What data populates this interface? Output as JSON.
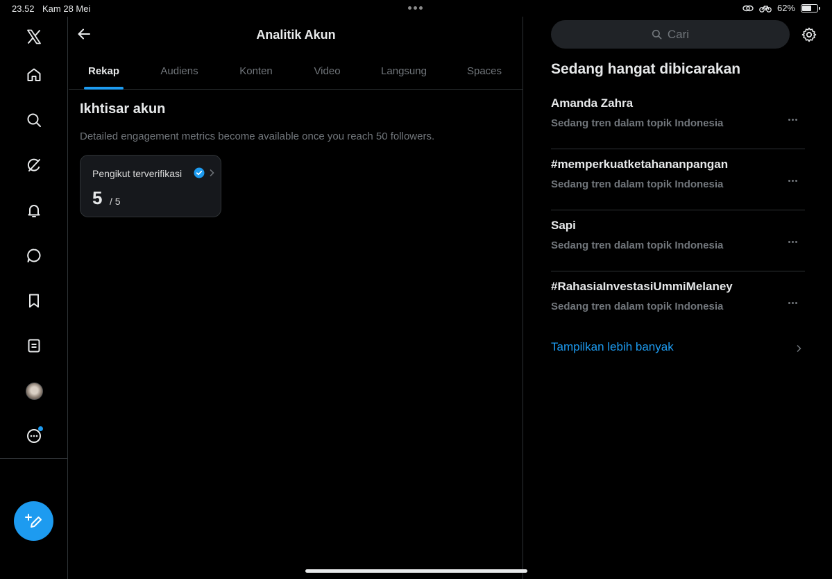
{
  "status_bar": {
    "time": "23.52",
    "date": "Kam 28 Mei",
    "battery_text": "62%",
    "battery_level": 0.62
  },
  "nav": {
    "icons": [
      "x-logo-icon",
      "home-icon",
      "search-icon",
      "grok-icon",
      "notifications-bell-icon",
      "messages-icon",
      "bookmark-icon",
      "lists-icon",
      "avatar",
      "more-icon",
      "compose-icon"
    ]
  },
  "header": {
    "title": "Analitik Akun"
  },
  "tabs": [
    {
      "label": "Rekap",
      "active": true
    },
    {
      "label": "Audiens",
      "active": false
    },
    {
      "label": "Konten",
      "active": false
    },
    {
      "label": "Video",
      "active": false
    },
    {
      "label": "Langsung",
      "active": false
    },
    {
      "label": "Spaces",
      "active": false
    }
  ],
  "overview": {
    "title": "Ikhtisar akun",
    "description": "Detailed engagement metrics become available once you reach 50 followers.",
    "card": {
      "label": "Pengikut terverifikasi",
      "value": "5",
      "total": "/ 5"
    }
  },
  "search": {
    "placeholder": "Cari"
  },
  "trending": {
    "heading": "Sedang hangat dibicarakan",
    "items": [
      {
        "name": "Amanda Zahra",
        "meta": "Sedang tren dalam topik Indonesia"
      },
      {
        "name": "#memperkuatketahananpangan",
        "meta": "Sedang tren dalam topik Indonesia"
      },
      {
        "name": "Sapi",
        "meta": "Sedang tren dalam topik Indonesia"
      },
      {
        "name": "#RahasiaInvestasiUmmiMelaney",
        "meta": "Sedang tren dalam topik Indonesia"
      }
    ],
    "show_more": "Tampilkan lebih banyak"
  },
  "colors": {
    "accent": "#1d9bf0",
    "background": "#000000",
    "border": "#2f3336",
    "muted_text": "#71767b"
  }
}
